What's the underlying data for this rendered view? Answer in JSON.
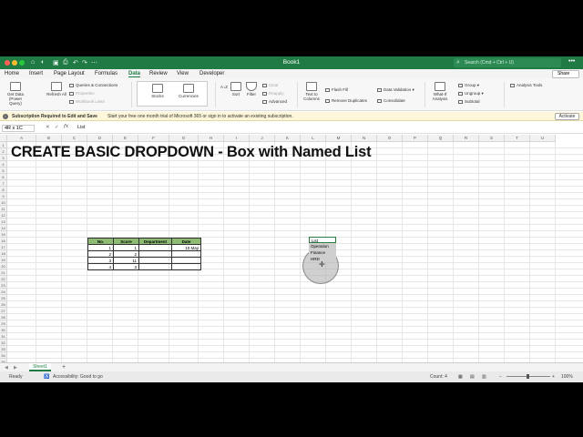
{
  "window": {
    "title": "Book1",
    "search_placeholder": "Search (Cmd + Ctrl + U)",
    "more": "•••"
  },
  "tabs": [
    "Home",
    "Insert",
    "Page Layout",
    "Formulas",
    "Data",
    "Review",
    "View",
    "Developer"
  ],
  "active_tab": "Data",
  "share_label": "Share",
  "ribbon": {
    "get_data": "Get Data (Power Query)",
    "refresh_all": "Refresh All",
    "queries_connections": "Queries & Connections",
    "properties": "Properties",
    "workbook_links": "Workbook Links",
    "stocks": "Stocks",
    "currencies": "Currencies",
    "sort": "Sort",
    "filter": "Filter",
    "clear": "Clear",
    "reapply": "Reapply",
    "advanced": "Advanced",
    "text_to_columns": "Text to Columns",
    "flash_fill": "Flash Fill",
    "remove_duplicates": "Remove Duplicates",
    "data_validation": "Data Validation",
    "consolidate": "Consolidate",
    "what_if": "What-If Analysis",
    "group": "Group",
    "ungroup": "Ungroup",
    "subtotal": "Subtotal",
    "analysis_tools": "Analysis Tools"
  },
  "notice": {
    "title": "Subscription Required to Edit and Save",
    "message": "Start your free one month trial of Microsoft 365 or sign in to activate an existing subscription.",
    "button": "Activate"
  },
  "formula_bar": {
    "name_box": "4R x 1C",
    "value": "List"
  },
  "columns": [
    "A",
    "B",
    "C",
    "D",
    "E",
    "F",
    "G",
    "H",
    "I",
    "J",
    "K",
    "L",
    "M",
    "N",
    "O",
    "P",
    "Q",
    "R",
    "S",
    "T",
    "U"
  ],
  "rows": [
    "1",
    "2",
    "3",
    "4",
    "5",
    "6",
    "7",
    "8",
    "9",
    "10",
    "11",
    "12",
    "13",
    "14",
    "15",
    "16",
    "17",
    "18",
    "19",
    "20",
    "21",
    "22",
    "23",
    "24",
    "25",
    "26",
    "27",
    "28",
    "29",
    "30",
    "31",
    "32",
    "33",
    "34",
    "35"
  ],
  "headline": "CREATE BASIC DROPDOWN - Box with Named List",
  "table": {
    "headers": [
      "No.",
      "Score",
      "Department",
      "Date"
    ],
    "rows": [
      [
        "1",
        "1",
        "",
        "10 May"
      ],
      [
        "2",
        "2",
        "",
        ""
      ],
      [
        "3",
        "11",
        "",
        ""
      ],
      [
        "4",
        "3",
        "",
        ""
      ]
    ]
  },
  "list_values": [
    "List",
    "Operation",
    "Finance",
    "HRD"
  ],
  "sheet_tab": "Sheet1",
  "status": {
    "ready": "Ready",
    "accessibility": "Accessibility: Good to go",
    "count": "Count: 4",
    "zoom": "100%"
  }
}
